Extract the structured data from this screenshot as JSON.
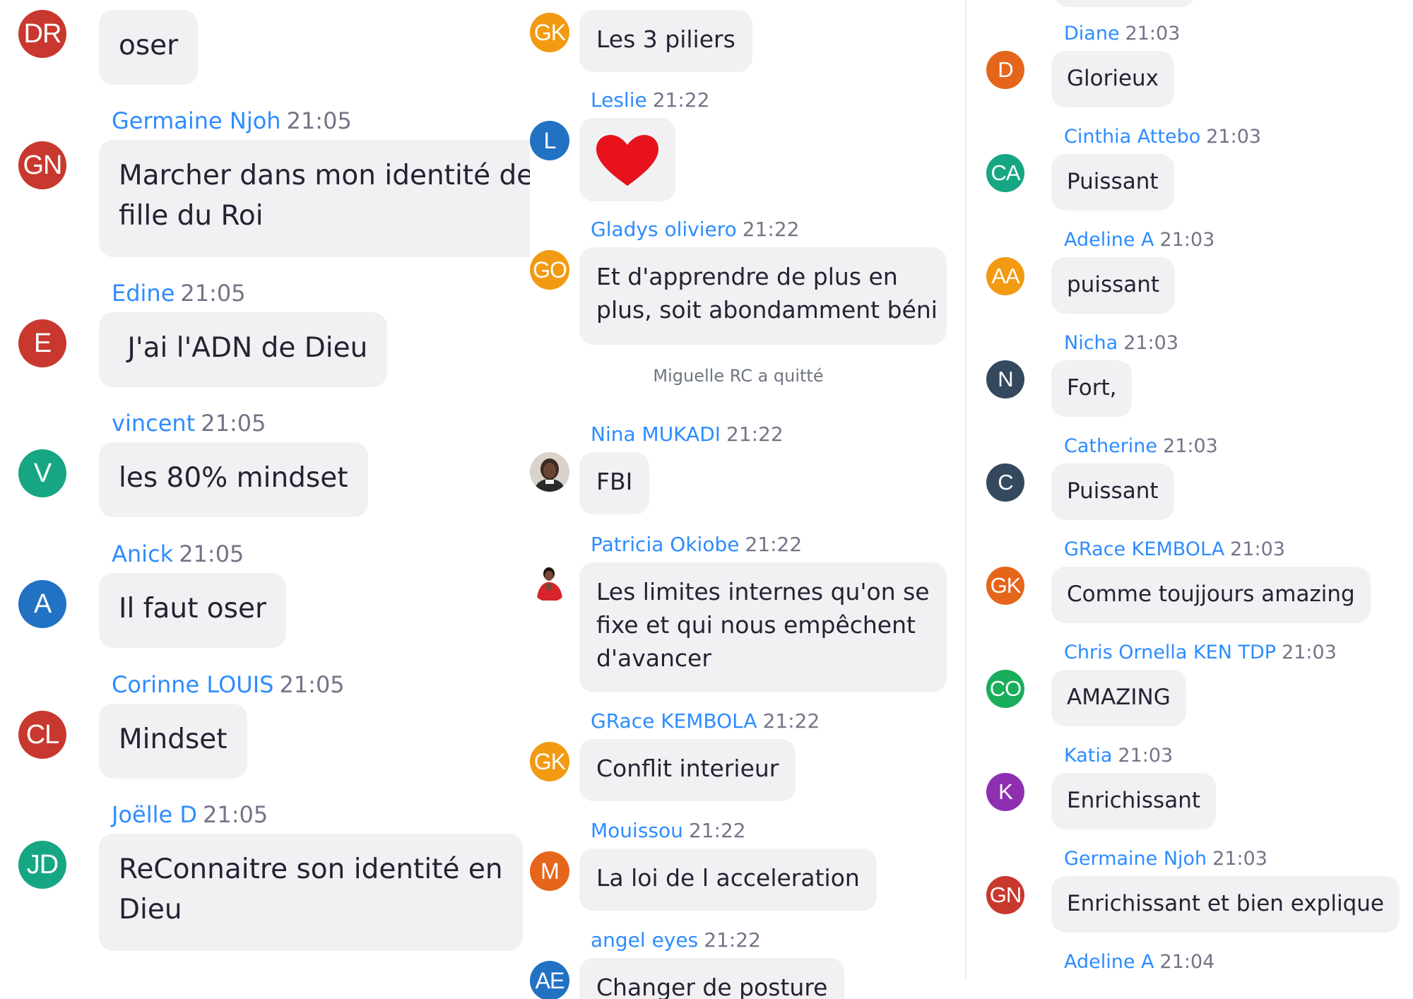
{
  "panel1": [
    {
      "initials": "DR",
      "color": "#c8382e",
      "sender": "",
      "time": "",
      "text": "oser"
    },
    {
      "initials": "GN",
      "color": "#c8382e",
      "sender": "Germaine Njoh",
      "time": "21:05",
      "text": "Marcher dans mon identité de",
      "text2": "fille du Roi"
    },
    {
      "initials": "E",
      "color": "#c8382e",
      "sender": "Edine",
      "time": "21:05",
      "text": " J'ai l'ADN de Dieu"
    },
    {
      "initials": "V",
      "color": "#17a683",
      "sender": "vincent",
      "time": "21:05",
      "text": "les 80% mindset"
    },
    {
      "initials": "A",
      "color": "#2272c3",
      "sender": "Anick",
      "time": "21:05",
      "text": "Il faut oser"
    },
    {
      "initials": "CL",
      "color": "#c8382e",
      "sender": "Corinne LOUIS",
      "time": "21:05",
      "text": "Mindset"
    },
    {
      "initials": "JD",
      "color": "#17a683",
      "sender": "Joëlle D",
      "time": "21:05",
      "text": "ReConnaitre son identité en",
      "text2": "Dieu"
    }
  ],
  "panel2": [
    {
      "initials": "GK",
      "color": "#f29a12",
      "sender": "",
      "time": "",
      "text": "Les 3 piliers"
    },
    {
      "initials": "L",
      "color": "#2272c3",
      "sender": "Leslie",
      "time": "21:22",
      "text": "",
      "emoji": "heart"
    },
    {
      "initials": "GO",
      "color": "#f29a12",
      "sender": "Gladys oliviero",
      "time": "21:22",
      "text": "Et d'apprendre de plus en",
      "text2": "plus, soit abondamment béni"
    },
    {
      "initials": "",
      "color": "#5a3a2a",
      "sender": "Nina MUKADI",
      "time": "21:22",
      "text": "FBI",
      "photo": "photo-avatar"
    },
    {
      "initials": "",
      "color": "#ffffff",
      "sender": "Patricia Okiobe",
      "time": "21:22",
      "text": "Les limites internes qu'on se",
      "text2": "fixe et qui nous empêchent",
      "text3": "d'avancer",
      "photo": "photo-avatar"
    },
    {
      "initials": "GK",
      "color": "#f29a12",
      "sender": "GRace KEMBOLA",
      "time": "21:22",
      "text": "Conflit interieur"
    },
    {
      "initials": "M",
      "color": "#e5661a",
      "sender": "Mouissou",
      "time": "21:22",
      "text": "La loi de l acceleration"
    },
    {
      "initials": "AE",
      "color": "#2272c3",
      "sender": "angel eyes",
      "time": "21:22",
      "text": "Changer de posture"
    }
  ],
  "system_message": "Miguelle RC a quitté",
  "panel3": [
    {
      "initials": "D",
      "color": "#e5661a",
      "sender": "Diane",
      "time": "21:03",
      "text": "Glorieux"
    },
    {
      "initials": "CA",
      "color": "#17a683",
      "sender": "Cinthia Attebo",
      "time": "21:03",
      "text": "Puissant"
    },
    {
      "initials": "AA",
      "color": "#f29a12",
      "sender": "Adeline A",
      "time": "21:03",
      "text": "puissant"
    },
    {
      "initials": "N",
      "color": "#34495e",
      "sender": "Nicha",
      "time": "21:03",
      "text": "Fort,"
    },
    {
      "initials": "C",
      "color": "#34495e",
      "sender": "Catherine",
      "time": "21:03",
      "text": "Puissant"
    },
    {
      "initials": "GK",
      "color": "#e5661a",
      "sender": "GRace KEMBOLA",
      "time": "21:03",
      "text": "Comme toujjours amazing"
    },
    {
      "initials": "CO",
      "color": "#1aad5c",
      "sender": "Chris Ornella KEN TDP",
      "time": "21:03",
      "text": "AMAZING"
    },
    {
      "initials": "K",
      "color": "#8e2fb0",
      "sender": "Katia",
      "time": "21:03",
      "text": "Enrichissant"
    },
    {
      "initials": "GN",
      "color": "#c8382e",
      "sender": "Germaine Njoh",
      "time": "21:03",
      "text": "Enrichissant et bien explique"
    },
    {
      "initials": "",
      "color": "#f29a12",
      "sender": "Adeline A",
      "time": "21:04",
      "text": ""
    }
  ]
}
